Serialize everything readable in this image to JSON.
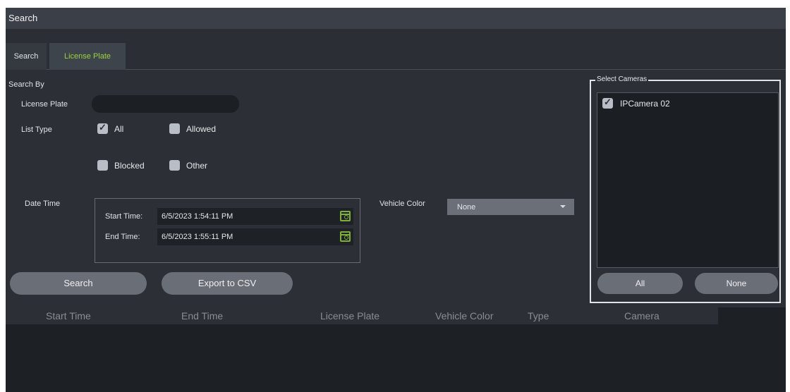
{
  "window": {
    "title": "Search"
  },
  "tabs": [
    {
      "label": "Search",
      "active": false
    },
    {
      "label": "License Plate",
      "active": true
    }
  ],
  "search_by": {
    "heading": "Search By",
    "license_plate": {
      "label": "License Plate",
      "value": ""
    },
    "list_type": {
      "label": "List Type",
      "options": [
        {
          "label": "All",
          "checked": true
        },
        {
          "label": "Allowed",
          "checked": false
        },
        {
          "label": "Blocked",
          "checked": false
        },
        {
          "label": "Other",
          "checked": false
        }
      ]
    },
    "date_time": {
      "label": "Date Time",
      "start": {
        "label": "Start Time:",
        "value": "6/5/2023 1:54:11 PM"
      },
      "end": {
        "label": "End Time:",
        "value": "6/5/2023 1:55:11 PM"
      }
    },
    "vehicle_color": {
      "label": "Vehicle Color",
      "selected": "None"
    }
  },
  "buttons": {
    "search": "Search",
    "export": "Export to CSV"
  },
  "cameras": {
    "legend": "Select Cameras",
    "items": [
      {
        "label": "IPCamera 02",
        "checked": true
      }
    ],
    "all_label": "All",
    "none_label": "None"
  },
  "results": {
    "columns": [
      "Start Time",
      "End Time",
      "License Plate",
      "Vehicle Color",
      "Type",
      "Camera"
    ],
    "rows": []
  },
  "colors": {
    "accent": "#9bd23c",
    "icon": "#7fae3a",
    "panel": "#2c3036"
  },
  "icons": {
    "calendar": "calendar-icon",
    "checkbox": "checkbox-icon",
    "dropdown": "chevron-down-icon"
  }
}
